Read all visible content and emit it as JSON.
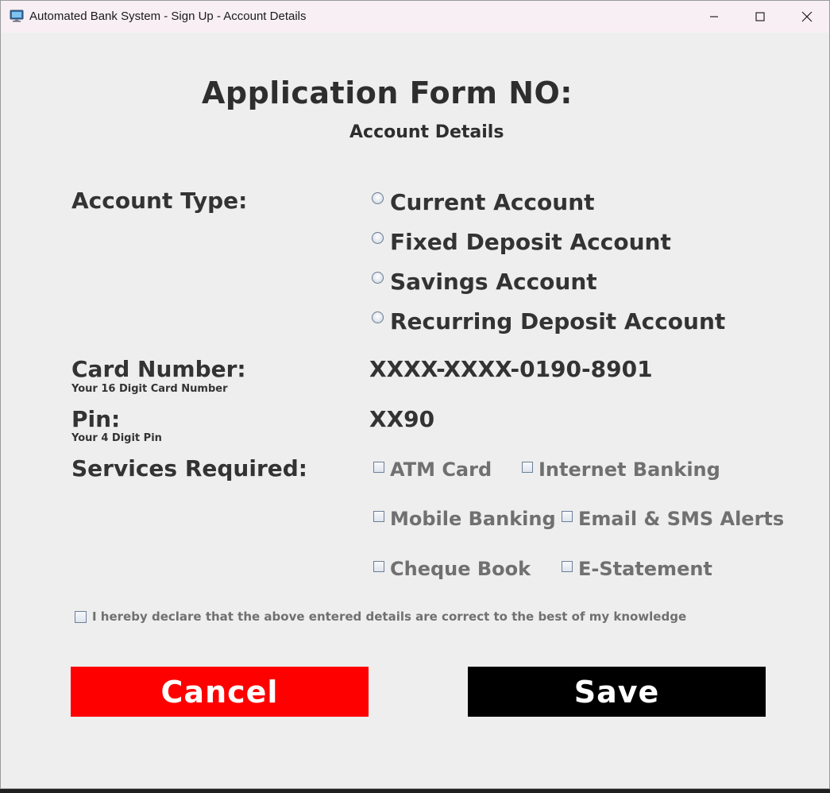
{
  "window": {
    "title": "Automated Bank System - Sign Up - Account Details",
    "icon": "computer-monitor-icon"
  },
  "form": {
    "title": "Application Form NO:",
    "subtitle": "Account Details"
  },
  "account_type": {
    "label": "Account Type:",
    "options": [
      "Current Account",
      "Fixed Deposit Account",
      "Savings Account",
      "Recurring Deposit Account"
    ],
    "selected": null
  },
  "card_number": {
    "label": "Card Number:",
    "hint": "Your 16 Digit Card Number",
    "value": "XXXX-XXXX-0190-8901"
  },
  "pin": {
    "label": "Pin:",
    "hint": "Your 4 Digit Pin",
    "value": "XX90"
  },
  "services": {
    "label": "Services Required:",
    "options": [
      "ATM Card",
      "Internet Banking",
      "Mobile Banking",
      "Email & SMS Alerts",
      "Cheque Book",
      "E-Statement"
    ],
    "checked": [
      false,
      false,
      false,
      false,
      false,
      false
    ]
  },
  "declaration": {
    "text": "I hereby declare that the above entered details are correct to the best of my knowledge",
    "checked": false
  },
  "buttons": {
    "cancel": "Cancel",
    "save": "Save"
  },
  "colors": {
    "cancel_bg": "#ff0000",
    "save_bg": "#000000",
    "window_bg": "#eeeeee",
    "titlebar_bg": "#f8eff5"
  }
}
